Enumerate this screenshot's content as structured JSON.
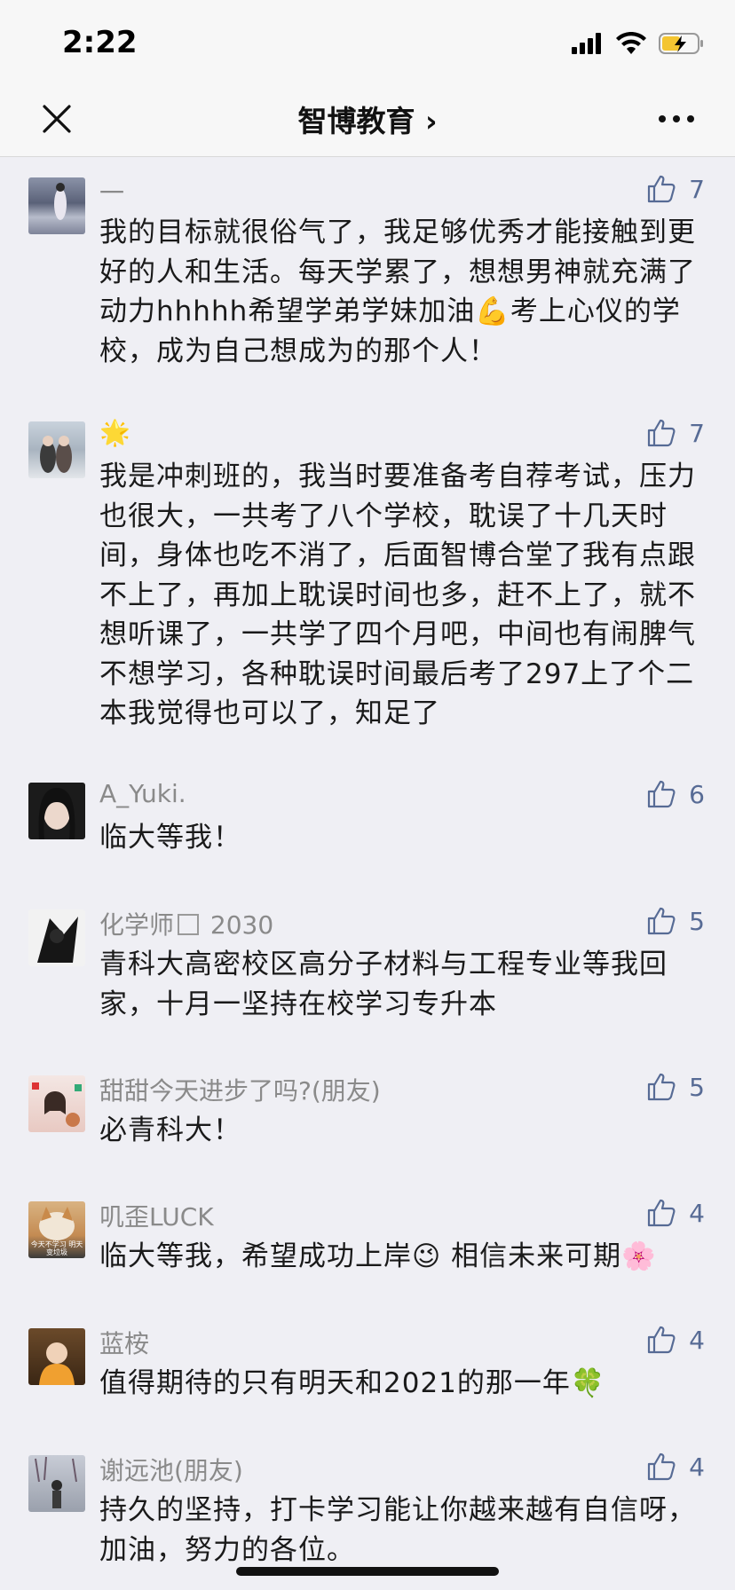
{
  "status": {
    "time": "2:22"
  },
  "nav": {
    "title": "智博教育 ›",
    "close_icon": "close-icon",
    "more_icon": "more-icon"
  },
  "comments": [
    {
      "name": "一",
      "likes": "7",
      "text": "我的目标就很俗气了，我足够优秀才能接触到更好的人和生活。每天学累了，想想男神就充满了动力hhhhh希望学弟学妹加油💪考上心仪的学校，成为自己想成为的那个人！"
    },
    {
      "name": "🌟",
      "likes": "7",
      "text": "我是冲刺班的，我当时要准备考自荐考试，压力也很大，一共考了八个学校，耽误了十几天时间，身体也吃不消了，后面智博合堂了我有点跟不上了，再加上耽误时间也多，赶不上了，就不想听课了，一共学了四个月吧，中间也有闹脾气不想学习，各种耽误时间最后考了297上了个二本我觉得也可以了，知足了"
    },
    {
      "name": "A_Yuki.",
      "likes": "6",
      "text": "临大等我！"
    },
    {
      "name_prefix": "化学师",
      "name_suffix": " 2030",
      "likes": "5",
      "text": "青科大高密校区高分子材料与工程专业等我回家，十月一坚持在校学习专升本"
    },
    {
      "name": "甜甜今天进步了吗?(朋友)",
      "likes": "5",
      "text": "必青科大！"
    },
    {
      "name": "叽歪LUCK",
      "likes": "4",
      "text": "临大等我，希望成功上岸😉 相信未来可期🌸"
    },
    {
      "name": "蓝桉",
      "likes": "4",
      "text": "值得期待的只有明天和2021的那一年🍀"
    },
    {
      "name": "谢远池(朋友)",
      "likes": "4",
      "text": "持久的坚持，打卡学习能让你越来越有自信呀，加油，努力的各位。"
    }
  ],
  "avatar_thumb_text": "今天不学习 明天变垃圾"
}
